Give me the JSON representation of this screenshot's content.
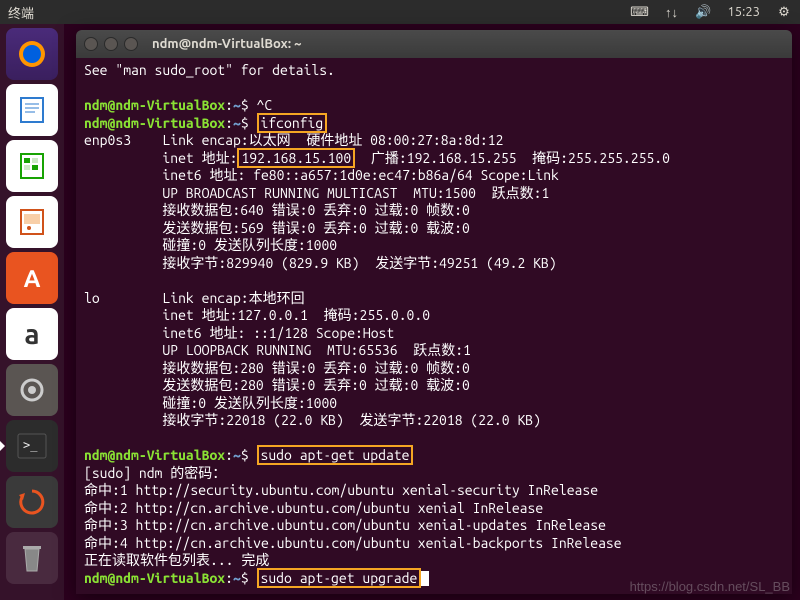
{
  "topbar": {
    "title": "终端",
    "time": "15:23"
  },
  "launcher": {
    "items": [
      {
        "name": "firefox",
        "glyph": "🦊"
      },
      {
        "name": "writer",
        "glyph": "📄"
      },
      {
        "name": "calc",
        "glyph": "📊"
      },
      {
        "name": "impress",
        "glyph": "📑"
      },
      {
        "name": "software",
        "glyph": "A"
      },
      {
        "name": "amazon",
        "glyph": "a"
      },
      {
        "name": "settings",
        "glyph": "⚙"
      },
      {
        "name": "terminal",
        "glyph": ">_"
      },
      {
        "name": "updater",
        "glyph": "⟳"
      },
      {
        "name": "trash",
        "glyph": "🗑"
      }
    ]
  },
  "window": {
    "title": "ndm@ndm-VirtualBox: ~"
  },
  "term": {
    "l0": "See \"man sudo_root\" for details.",
    "user": "ndm@ndm-VirtualBox",
    "path": "~",
    "cmd_ac": "^C",
    "cmd_ifconfig": "ifconfig",
    "if1": "enp0s3    Link encap:以太网  硬件地址 08:00:27:8a:8d:12",
    "if2a": "          inet 地址:",
    "ip": "192.168.15.100",
    "if2b": "  广播:192.168.15.255  掩码:255.255.255.0",
    "if3": "          inet6 地址: fe80::a657:1d0e:ec47:b86a/64 Scope:Link",
    "if4": "          UP BROADCAST RUNNING MULTICAST  MTU:1500  跃点数:1",
    "if5": "          接收数据包:640 错误:0 丢弃:0 过载:0 帧数:0",
    "if6": "          发送数据包:569 错误:0 丢弃:0 过载:0 载波:0",
    "if7": "          碰撞:0 发送队列长度:1000",
    "if8": "          接收字节:829940 (829.9 KB)  发送字节:49251 (49.2 KB)",
    "lo1": "lo        Link encap:本地环回",
    "lo2": "          inet 地址:127.0.0.1  掩码:255.0.0.0",
    "lo3": "          inet6 地址: ::1/128 Scope:Host",
    "lo4": "          UP LOOPBACK RUNNING  MTU:65536  跃点数:1",
    "lo5": "          接收数据包:280 错误:0 丢弃:0 过载:0 帧数:0",
    "lo6": "          发送数据包:280 错误:0 丢弃:0 过载:0 载波:0",
    "lo7": "          碰撞:0 发送队列长度:1000",
    "lo8": "          接收字节:22018 (22.0 KB)  发送字节:22018 (22.0 KB)",
    "cmd_update": "sudo apt-get update",
    "sudo_pw": "[sudo] ndm 的密码：",
    "hit1": "命中:1 http://security.ubuntu.com/ubuntu xenial-security InRelease",
    "hit2": "命中:2 http://cn.archive.ubuntu.com/ubuntu xenial InRelease",
    "hit3": "命中:3 http://cn.archive.ubuntu.com/ubuntu xenial-updates InRelease",
    "hit4": "命中:4 http://cn.archive.ubuntu.com/ubuntu xenial-backports InRelease",
    "reading": "正在读取软件包列表... 完成",
    "cmd_upgrade": "sudo apt-get upgrade"
  },
  "watermark": "https://blog.csdn.net/SL_BB"
}
